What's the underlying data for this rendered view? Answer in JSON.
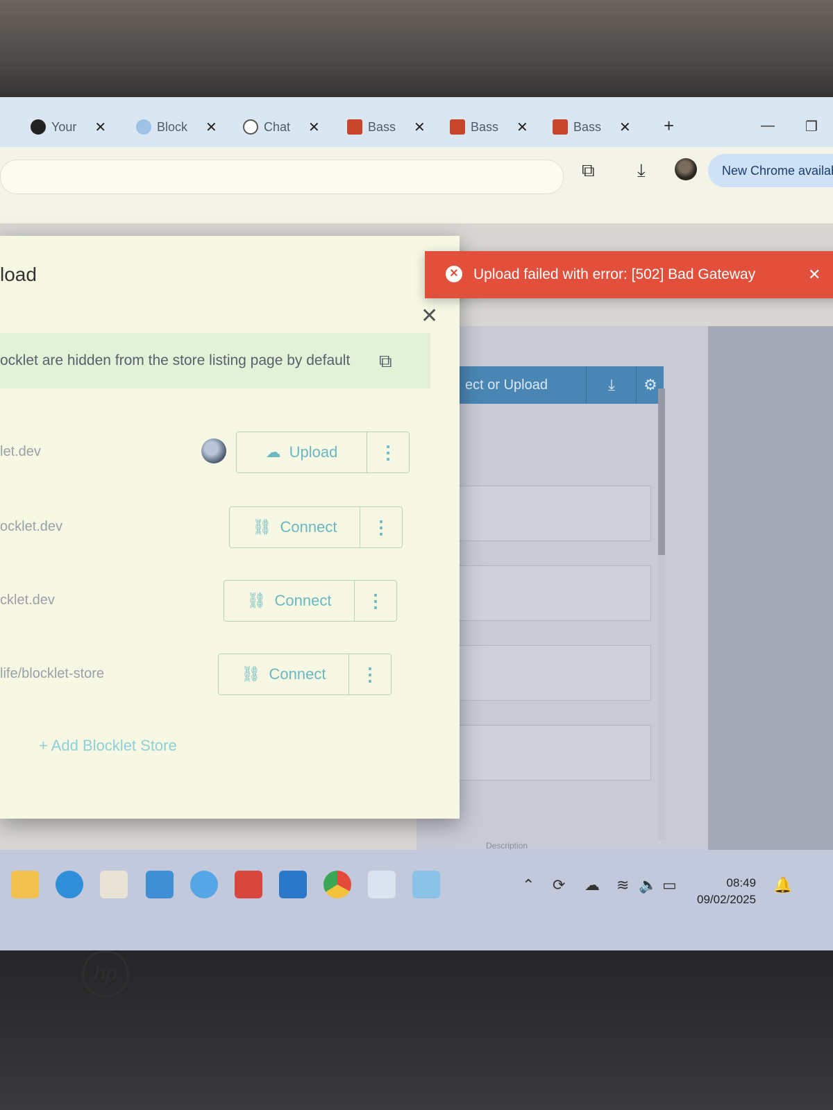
{
  "browser": {
    "tabs": [
      {
        "label": "Your",
        "icon": "github-icon"
      },
      {
        "label": "Block",
        "icon": "blocklet-icon"
      },
      {
        "label": "Chat",
        "icon": "openai-icon"
      },
      {
        "label": "Bass",
        "icon": "rm-icon"
      },
      {
        "label": "Bass",
        "icon": "rm-icon"
      },
      {
        "label": "Bass",
        "icon": "rm-icon"
      }
    ],
    "tab_close": "✕",
    "new_tab": "+",
    "update_pill": "New Chrome availab"
  },
  "modal": {
    "title": "load",
    "info_text": "ocklet are hidden from the store listing page by default",
    "stores": [
      {
        "host": "let.dev",
        "action": "Upload",
        "icon": "cloud-upload-icon"
      },
      {
        "host": "ocklet.dev",
        "action": "Connect",
        "icon": "link-icon"
      },
      {
        "host": "cklet.dev",
        "action": "Connect",
        "icon": "link-icon"
      },
      {
        "host": "life/blocklet-store",
        "action": "Connect",
        "icon": "link-icon"
      }
    ],
    "add_store": "+ Add Blocklet Store"
  },
  "toast": {
    "message": "Upload failed with error: [502] Bad Gateway",
    "color": "#e2503c"
  },
  "background_panel": {
    "header": "ect or Upload",
    "description_label": "Description"
  },
  "taskbar": {
    "time": "08:49",
    "date": "09/02/2025"
  }
}
